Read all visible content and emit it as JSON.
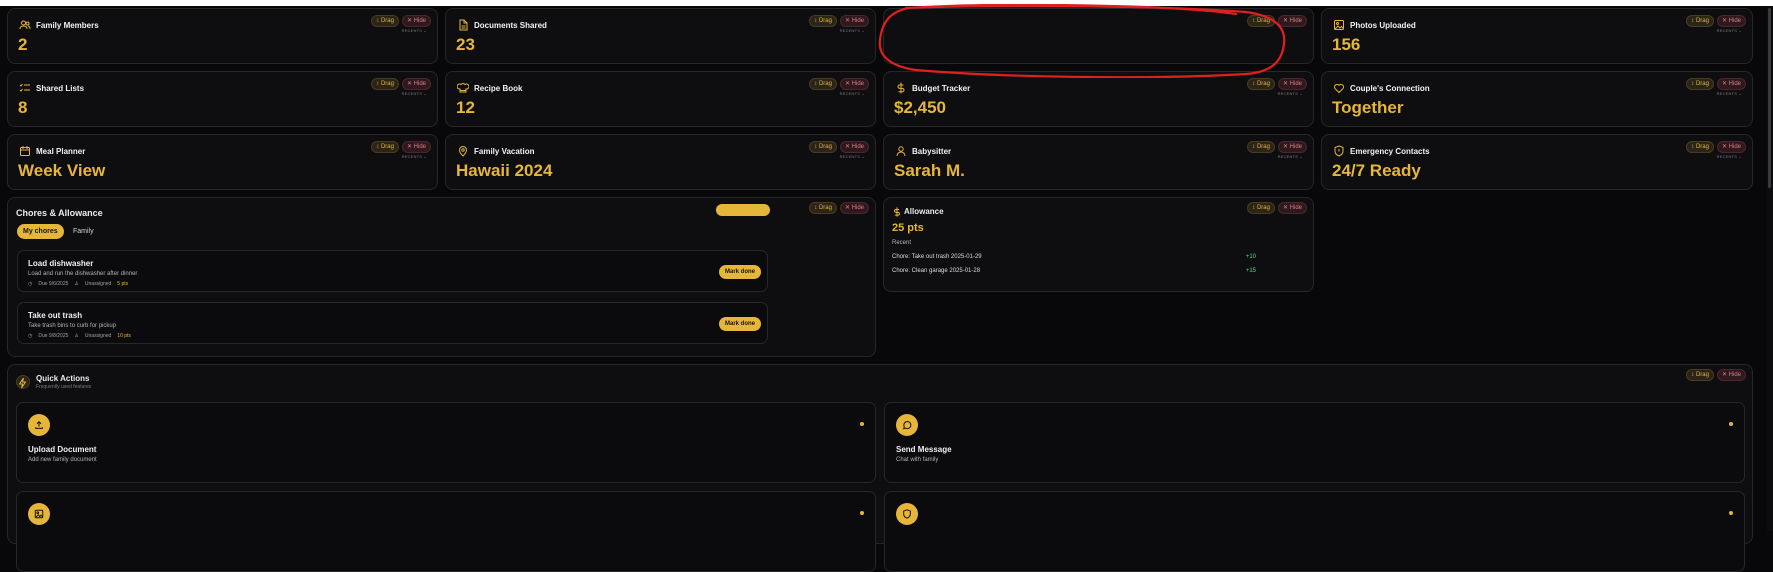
{
  "controls": {
    "drag": "↕ Drag",
    "hide": "✕ Hide",
    "recents": "RECENTS ⌄"
  },
  "stats": [
    {
      "title": "Family Members",
      "value": "2",
      "icon": "users-icon"
    },
    {
      "title": "Documents Shared",
      "value": "23",
      "icon": "document-icon"
    },
    {
      "title": "",
      "value": "",
      "icon": ""
    },
    {
      "title": "Photos Uploaded",
      "value": "156",
      "icon": "image-icon"
    },
    {
      "title": "Shared Lists",
      "value": "8",
      "icon": "list-icon"
    },
    {
      "title": "Recipe Book",
      "value": "12",
      "icon": "chef-hat-icon"
    },
    {
      "title": "Budget Tracker",
      "value": "$2,450",
      "icon": "dollar-icon"
    },
    {
      "title": "Couple's Connection",
      "value": "Together",
      "icon": "heart-icon"
    },
    {
      "title": "Meal Planner",
      "value": "Week View",
      "icon": "calendar-icon"
    },
    {
      "title": "Family Vacation",
      "value": "Hawaii 2024",
      "icon": "map-pin-icon"
    },
    {
      "title": "Babysitter",
      "value": "Sarah M.",
      "icon": "user-icon"
    },
    {
      "title": "Emergency Contacts",
      "value": "24/7 Ready",
      "icon": "shield-icon"
    }
  ],
  "chores": {
    "title": "Chores & Allowance",
    "tabs": [
      "My chores",
      "Family"
    ],
    "items": [
      {
        "title": "Load dishwasher",
        "desc": "Load and run the dishwasher after dinner",
        "due": "Due 9/6/2025",
        "assignee": "Unassigned",
        "pts": "5 pts",
        "action": "Mark done"
      },
      {
        "title": "Take out trash",
        "desc": "Take trash bins to curb for pickup",
        "due": "Due 9/8/2025",
        "assignee": "Unassigned",
        "pts": "10 pts",
        "action": "Mark done"
      }
    ]
  },
  "allowance": {
    "title": "Allowance",
    "value": "25 pts",
    "recent_label": "Recent",
    "rows": [
      {
        "text": "Chore: Take out trash 2025-01-29",
        "pts": "+10"
      },
      {
        "text": "Chore: Clean garage 2025-01-28",
        "pts": "+15"
      }
    ]
  },
  "quick_actions": {
    "title": "Quick Actions",
    "subtitle": "Frequently used features",
    "cards": [
      {
        "title": "Upload Document",
        "desc": "Add new family document",
        "icon": "upload-icon"
      },
      {
        "title": "Send Message",
        "desc": "Chat with family",
        "icon": "message-icon"
      },
      {
        "title": "",
        "desc": "",
        "icon": "image-icon"
      },
      {
        "title": "",
        "desc": "",
        "icon": "shield-icon"
      }
    ]
  },
  "colors": {
    "accent": "#e6b63a",
    "background": "#08080a",
    "card": "#0e0e11",
    "annotation": "#e02020",
    "positive": "#4ade80"
  }
}
